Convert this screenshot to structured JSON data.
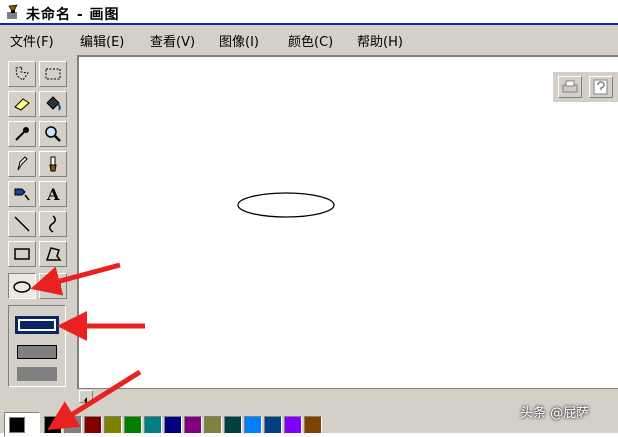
{
  "window": {
    "title": "未命名 - 画图",
    "icon": "paint-brush-icon"
  },
  "menu": [
    {
      "label": "文件(F)"
    },
    {
      "label": "编辑(E)"
    },
    {
      "label": "查看(V)"
    },
    {
      "label": "图像(I)"
    },
    {
      "label": "颜色(C)"
    },
    {
      "label": "帮助(H)"
    }
  ],
  "tools": [
    {
      "name": "free-form-select-icon"
    },
    {
      "name": "rect-select-icon"
    },
    {
      "name": "eraser-icon"
    },
    {
      "name": "fill-bucket-icon"
    },
    {
      "name": "pick-color-icon"
    },
    {
      "name": "magnifier-icon"
    },
    {
      "name": "pencil-icon"
    },
    {
      "name": "brush-icon"
    },
    {
      "name": "airbrush-icon"
    },
    {
      "name": "text-icon",
      "label": "A"
    },
    {
      "name": "line-icon"
    },
    {
      "name": "curve-icon"
    },
    {
      "name": "rectangle-icon"
    },
    {
      "name": "polygon-icon"
    },
    {
      "name": "ellipse-icon",
      "active": true
    },
    {
      "name": "rounded-rect-icon"
    }
  ],
  "fill_options": [
    {
      "name": "outline-only",
      "selected": true
    },
    {
      "name": "outline-and-fill"
    },
    {
      "name": "fill-only"
    }
  ],
  "colors": {
    "foreground": "#000000",
    "background": "#ffffff",
    "selection": "#0a246a",
    "arrow": "#e8231f",
    "palette": [
      "#000000",
      "#808080",
      "#800000",
      "#808000",
      "#008000",
      "#008080",
      "#000080",
      "#800080",
      "#808040",
      "#004040",
      "#0080ff",
      "#004080",
      "#8000ff",
      "#804000"
    ]
  },
  "watermark": "头条 @屁萨"
}
